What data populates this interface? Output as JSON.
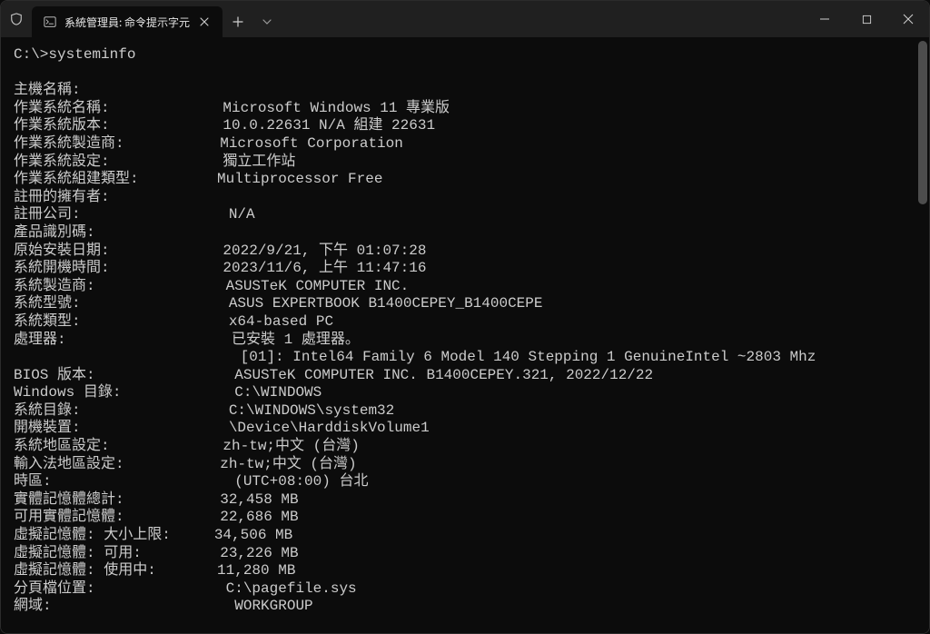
{
  "window": {
    "title": "系統管理員: 命令提示字元"
  },
  "term": {
    "prompt": "C:\\>systeminfo",
    "rows": [
      {
        "label": "主機名稱:",
        "value": ""
      },
      {
        "label": "作業系統名稱:",
        "value": "Microsoft Windows 11 專業版"
      },
      {
        "label": "作業系統版本:",
        "value": "10.0.22631 N/A 組建 22631"
      },
      {
        "label": "作業系統製造商:",
        "value": "Microsoft Corporation"
      },
      {
        "label": "作業系統設定:",
        "value": "獨立工作站"
      },
      {
        "label": "作業系統組建類型:",
        "value": "Multiprocessor Free"
      },
      {
        "label": "註冊的擁有者:",
        "value": ""
      },
      {
        "label": "註冊公司:",
        "value": "N/A"
      },
      {
        "label": "產品識別碼:",
        "value": ""
      },
      {
        "label": "原始安裝日期:",
        "value": "2022/9/21, 下午 01:07:28"
      },
      {
        "label": "系統開機時間:",
        "value": "2023/11/6, 上午 11:47:16"
      },
      {
        "label": "系統製造商:",
        "value": "ASUSTeK COMPUTER INC."
      },
      {
        "label": "系統型號:",
        "value": "ASUS EXPERTBOOK B1400CEPEY_B1400CEPE"
      },
      {
        "label": "系統類型:",
        "value": "x64-based PC"
      },
      {
        "label": "處理器:",
        "value": "已安裝 1 處理器。"
      },
      {
        "label": "",
        "value": "[01]: Intel64 Family 6 Model 140 Stepping 1 GenuineIntel ~2803 Mhz"
      },
      {
        "label": "BIOS 版本:",
        "value": "ASUSTeK COMPUTER INC. B1400CEPEY.321, 2022/12/22"
      },
      {
        "label": "Windows 目錄:",
        "value": "C:\\WINDOWS"
      },
      {
        "label": "系統目錄:",
        "value": "C:\\WINDOWS\\system32"
      },
      {
        "label": "開機裝置:",
        "value": "\\Device\\HarddiskVolume1"
      },
      {
        "label": "系統地區設定:",
        "value": "zh-tw;中文 (台灣)"
      },
      {
        "label": "輸入法地區設定:",
        "value": "zh-tw;中文 (台灣)"
      },
      {
        "label": "時區:",
        "value": "(UTC+08:00) 台北"
      },
      {
        "label": "實體記憶體總計:",
        "value": "32,458 MB"
      },
      {
        "label": "可用實體記憶體:",
        "value": "22,686 MB"
      },
      {
        "label": "虛擬記憶體: 大小上限:",
        "value": "34,506 MB"
      },
      {
        "label": "虛擬記憶體: 可用:",
        "value": "23,226 MB"
      },
      {
        "label": "虛擬記憶體: 使用中:",
        "value": "11,280 MB"
      },
      {
        "label": "分頁檔位置:",
        "value": "C:\\pagefile.sys"
      },
      {
        "label": "網域:",
        "value": "WORKGROUP"
      }
    ]
  }
}
